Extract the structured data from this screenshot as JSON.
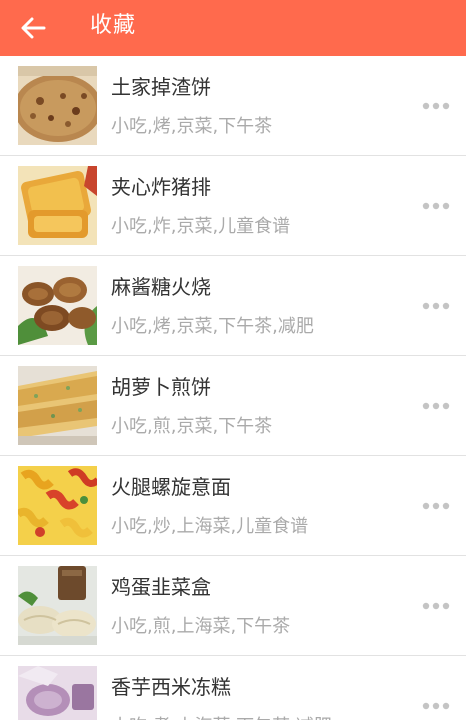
{
  "header": {
    "title": "收藏",
    "back_icon": "arrow-left-icon",
    "background_color": "#ff6a4d"
  },
  "favorites": [
    {
      "name": "土家掉渣饼",
      "tags": "小吃,烤,京菜,下午茶"
    },
    {
      "name": "夹心炸猪排",
      "tags": "小吃,炸,京菜,儿童食谱"
    },
    {
      "name": "麻酱糖火烧",
      "tags": "小吃,烤,京菜,下午茶,减肥"
    },
    {
      "name": "胡萝卜煎饼",
      "tags": "小吃,煎,京菜,下午茶"
    },
    {
      "name": "火腿螺旋意面",
      "tags": "小吃,炒,上海菜,儿童食谱"
    },
    {
      "name": "鸡蛋韭菜盒",
      "tags": "小吃,煎,上海菜,下午茶"
    },
    {
      "name": "香芋西米冻糕",
      "tags": "小吃,煮,上海菜,下午茶,减肥"
    }
  ],
  "icons": {
    "more": "more-dots-icon"
  }
}
